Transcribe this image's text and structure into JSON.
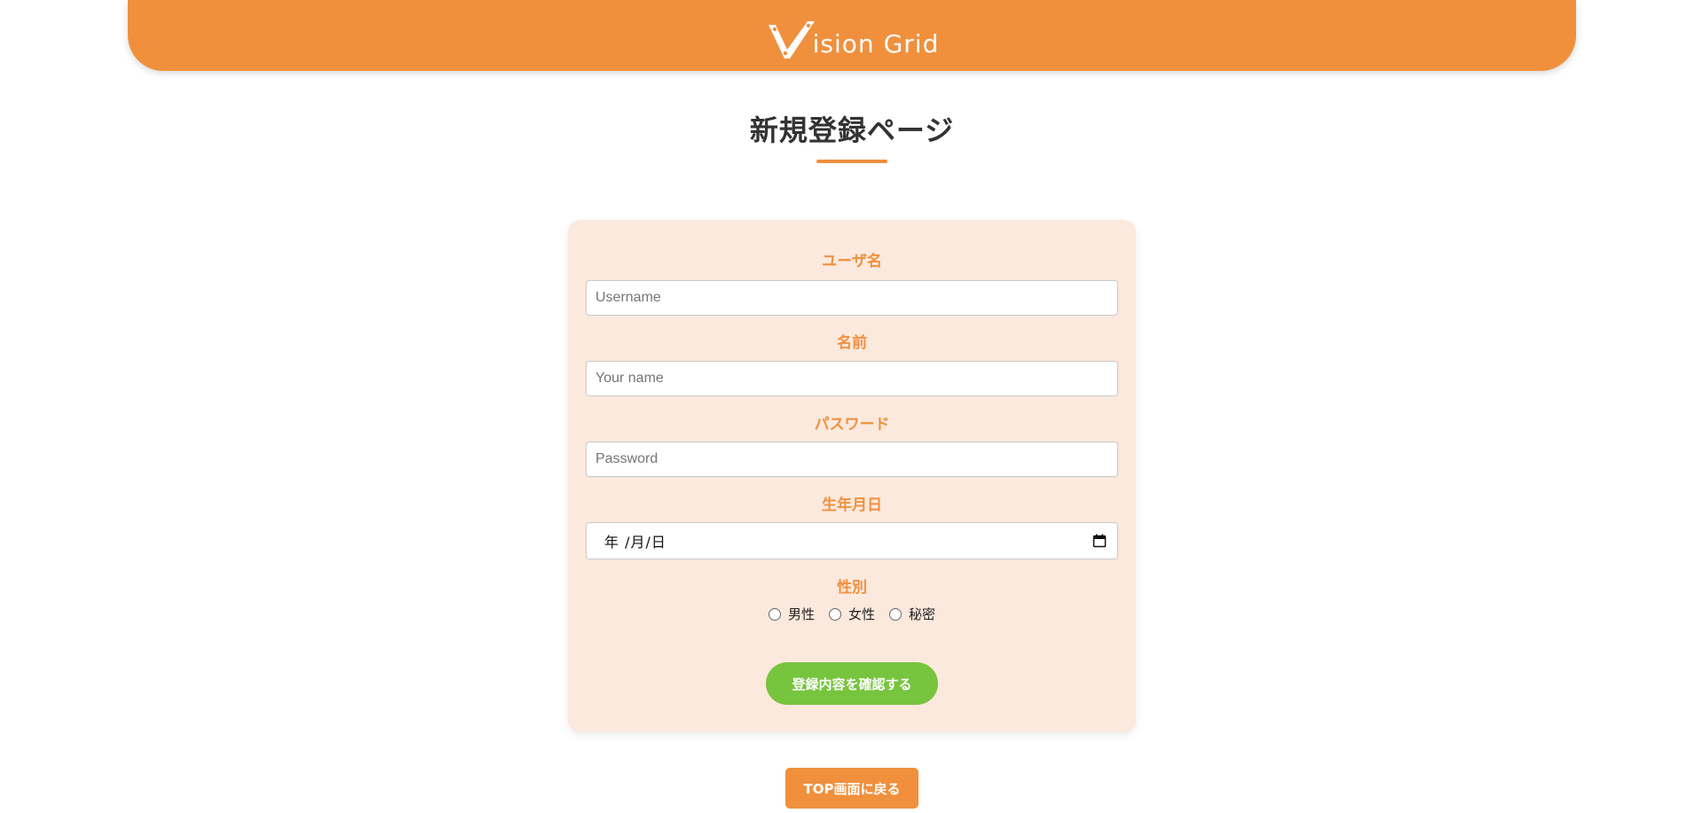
{
  "header": {
    "logo_text": "ision Grid",
    "logo_icon": "v-logo-icon",
    "brand_color": "#f0903d"
  },
  "page": {
    "title": "新規登録ページ"
  },
  "form": {
    "username_label": "ユーザ名",
    "username_placeholder": "Username",
    "name_label": "名前",
    "name_placeholder": "Your name",
    "password_label": "パスワード",
    "password_placeholder": "Password",
    "birthdate_label": "生年月日",
    "birthdate_value": "年 /月/日",
    "gender_label": "性別",
    "gender_options": [
      "男性",
      "女性",
      "秘密"
    ],
    "confirm_label": "登録内容を確認する",
    "confirm_color": "#77c43e",
    "card_color": "#fce9dd"
  },
  "footer": {
    "top_button_label": "TOP画面に戻る"
  }
}
